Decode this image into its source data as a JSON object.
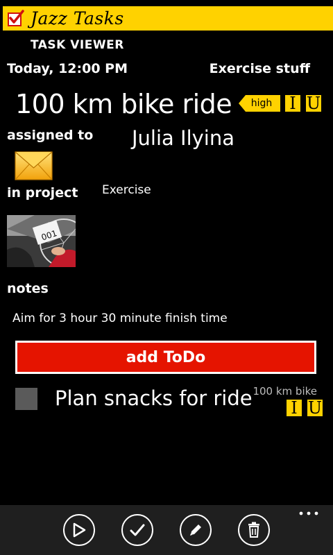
{
  "app": {
    "title": "Jazz Tasks"
  },
  "page": {
    "section_title": "TASK VIEWER"
  },
  "task": {
    "due": "Today, 12:00 PM",
    "category": "Exercise stuff",
    "title": "100 km bike ride",
    "priority": "high",
    "flags": [
      "I",
      "U"
    ],
    "assigned_label": "assigned to",
    "assignee": "Julia Ilyina",
    "project_label": "in project",
    "project": "Exercise",
    "notes_label": "notes",
    "notes": "Aim for 3 hour 30 minute finish time",
    "photo_number": "001"
  },
  "actions": {
    "add_todo": "add ToDo"
  },
  "todos": [
    {
      "text": "Plan snacks for ride",
      "parent": "100 km bike",
      "flags": [
        "I",
        "U"
      ],
      "checked": false
    }
  ],
  "appbar": {
    "buttons": [
      "play-icon",
      "check-icon",
      "edit-icon",
      "delete-icon"
    ],
    "more": "more-icon"
  },
  "colors": {
    "accent": "#FFD200",
    "button": "#E51400",
    "background": "#000000"
  }
}
